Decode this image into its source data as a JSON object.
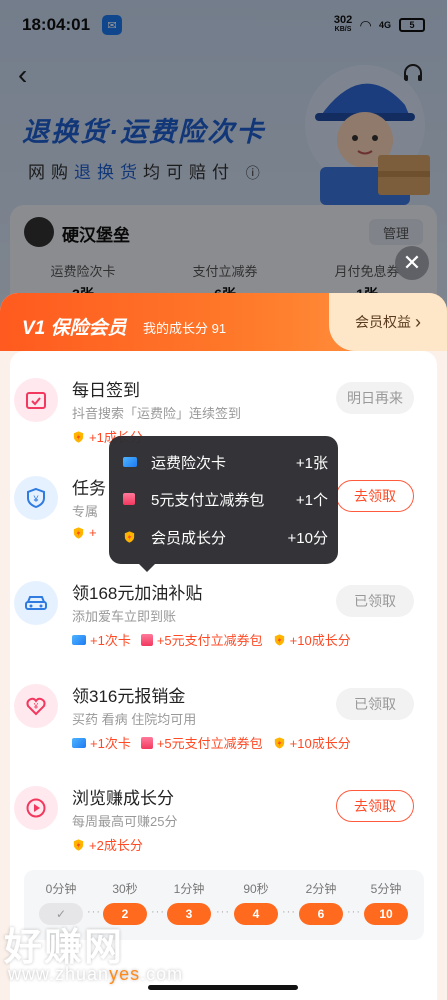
{
  "status_bar": {
    "time": "18:04:01",
    "net_speed": "302",
    "net_unit": "KB/S",
    "battery": "5",
    "signal": "4G"
  },
  "background": {
    "hero_title": "退换货·运费险次卡",
    "hero_sub_pre": "网购",
    "hero_sub_hl": "退换货",
    "hero_sub_post": "均可赔付",
    "username": "硬汉堡垒",
    "manage_label": "管理",
    "stats": [
      {
        "label": "运费险次卡",
        "value": "3张"
      },
      {
        "label": "支付立减券",
        "value": "6张"
      },
      {
        "label": "月付免息券",
        "value": "1张"
      }
    ]
  },
  "sheet": {
    "level": "V1 保险会员",
    "growth_text": "我的成长分 91",
    "benefits_label": "会员权益"
  },
  "tasks": [
    {
      "title": "每日签到",
      "desc": "抖音搜索「运费险」连续签到",
      "button": "明日再来",
      "button_style": "grey",
      "rewards": [
        "+1成长分"
      ],
      "icon": "calendar-icon"
    },
    {
      "title": "任务",
      "desc": "专属",
      "button": "去领取",
      "button_style": "orange",
      "rewards": [
        "+"
      ],
      "icon": "shield-icon"
    },
    {
      "title": "领168元加油补贴",
      "desc": "添加爱车立即到账",
      "button": "已领取",
      "button_style": "grey",
      "rewards": [
        "+1次卡",
        "+5元支付立减券包",
        "+10成长分"
      ],
      "icon": "car-icon"
    },
    {
      "title": "领316元报销金",
      "desc": "买药 看病 住院均可用",
      "button": "已领取",
      "button_style": "grey",
      "rewards": [
        "+1次卡",
        "+5元支付立减券包",
        "+10成长分"
      ],
      "icon": "yen-heart-icon"
    },
    {
      "title": "浏览赚成长分",
      "desc": "每周最高可赚25分",
      "button": "去领取",
      "button_style": "orange",
      "rewards": [
        "+2成长分"
      ],
      "icon": "play-icon"
    }
  ],
  "tooltip": [
    {
      "label": "运费险次卡",
      "value": "+1张"
    },
    {
      "label": "5元支付立减券包",
      "value": "+1个"
    },
    {
      "label": "会员成长分",
      "value": "+10分"
    }
  ],
  "timeline": {
    "labels": [
      "0分钟",
      "30秒",
      "1分钟",
      "90秒",
      "2分钟",
      "5分钟"
    ],
    "pills": [
      "✓",
      "2",
      "3",
      "4",
      "6",
      "10"
    ]
  },
  "watermark": {
    "brand": "好赚网",
    "url_pre": "www.zhuan",
    "url_hl": "yes",
    "url_post": ".com"
  },
  "colors": {
    "accent": "#ff5a1f",
    "brand_blue": "#1f5fd0",
    "reward_red": "#ff4a25"
  }
}
